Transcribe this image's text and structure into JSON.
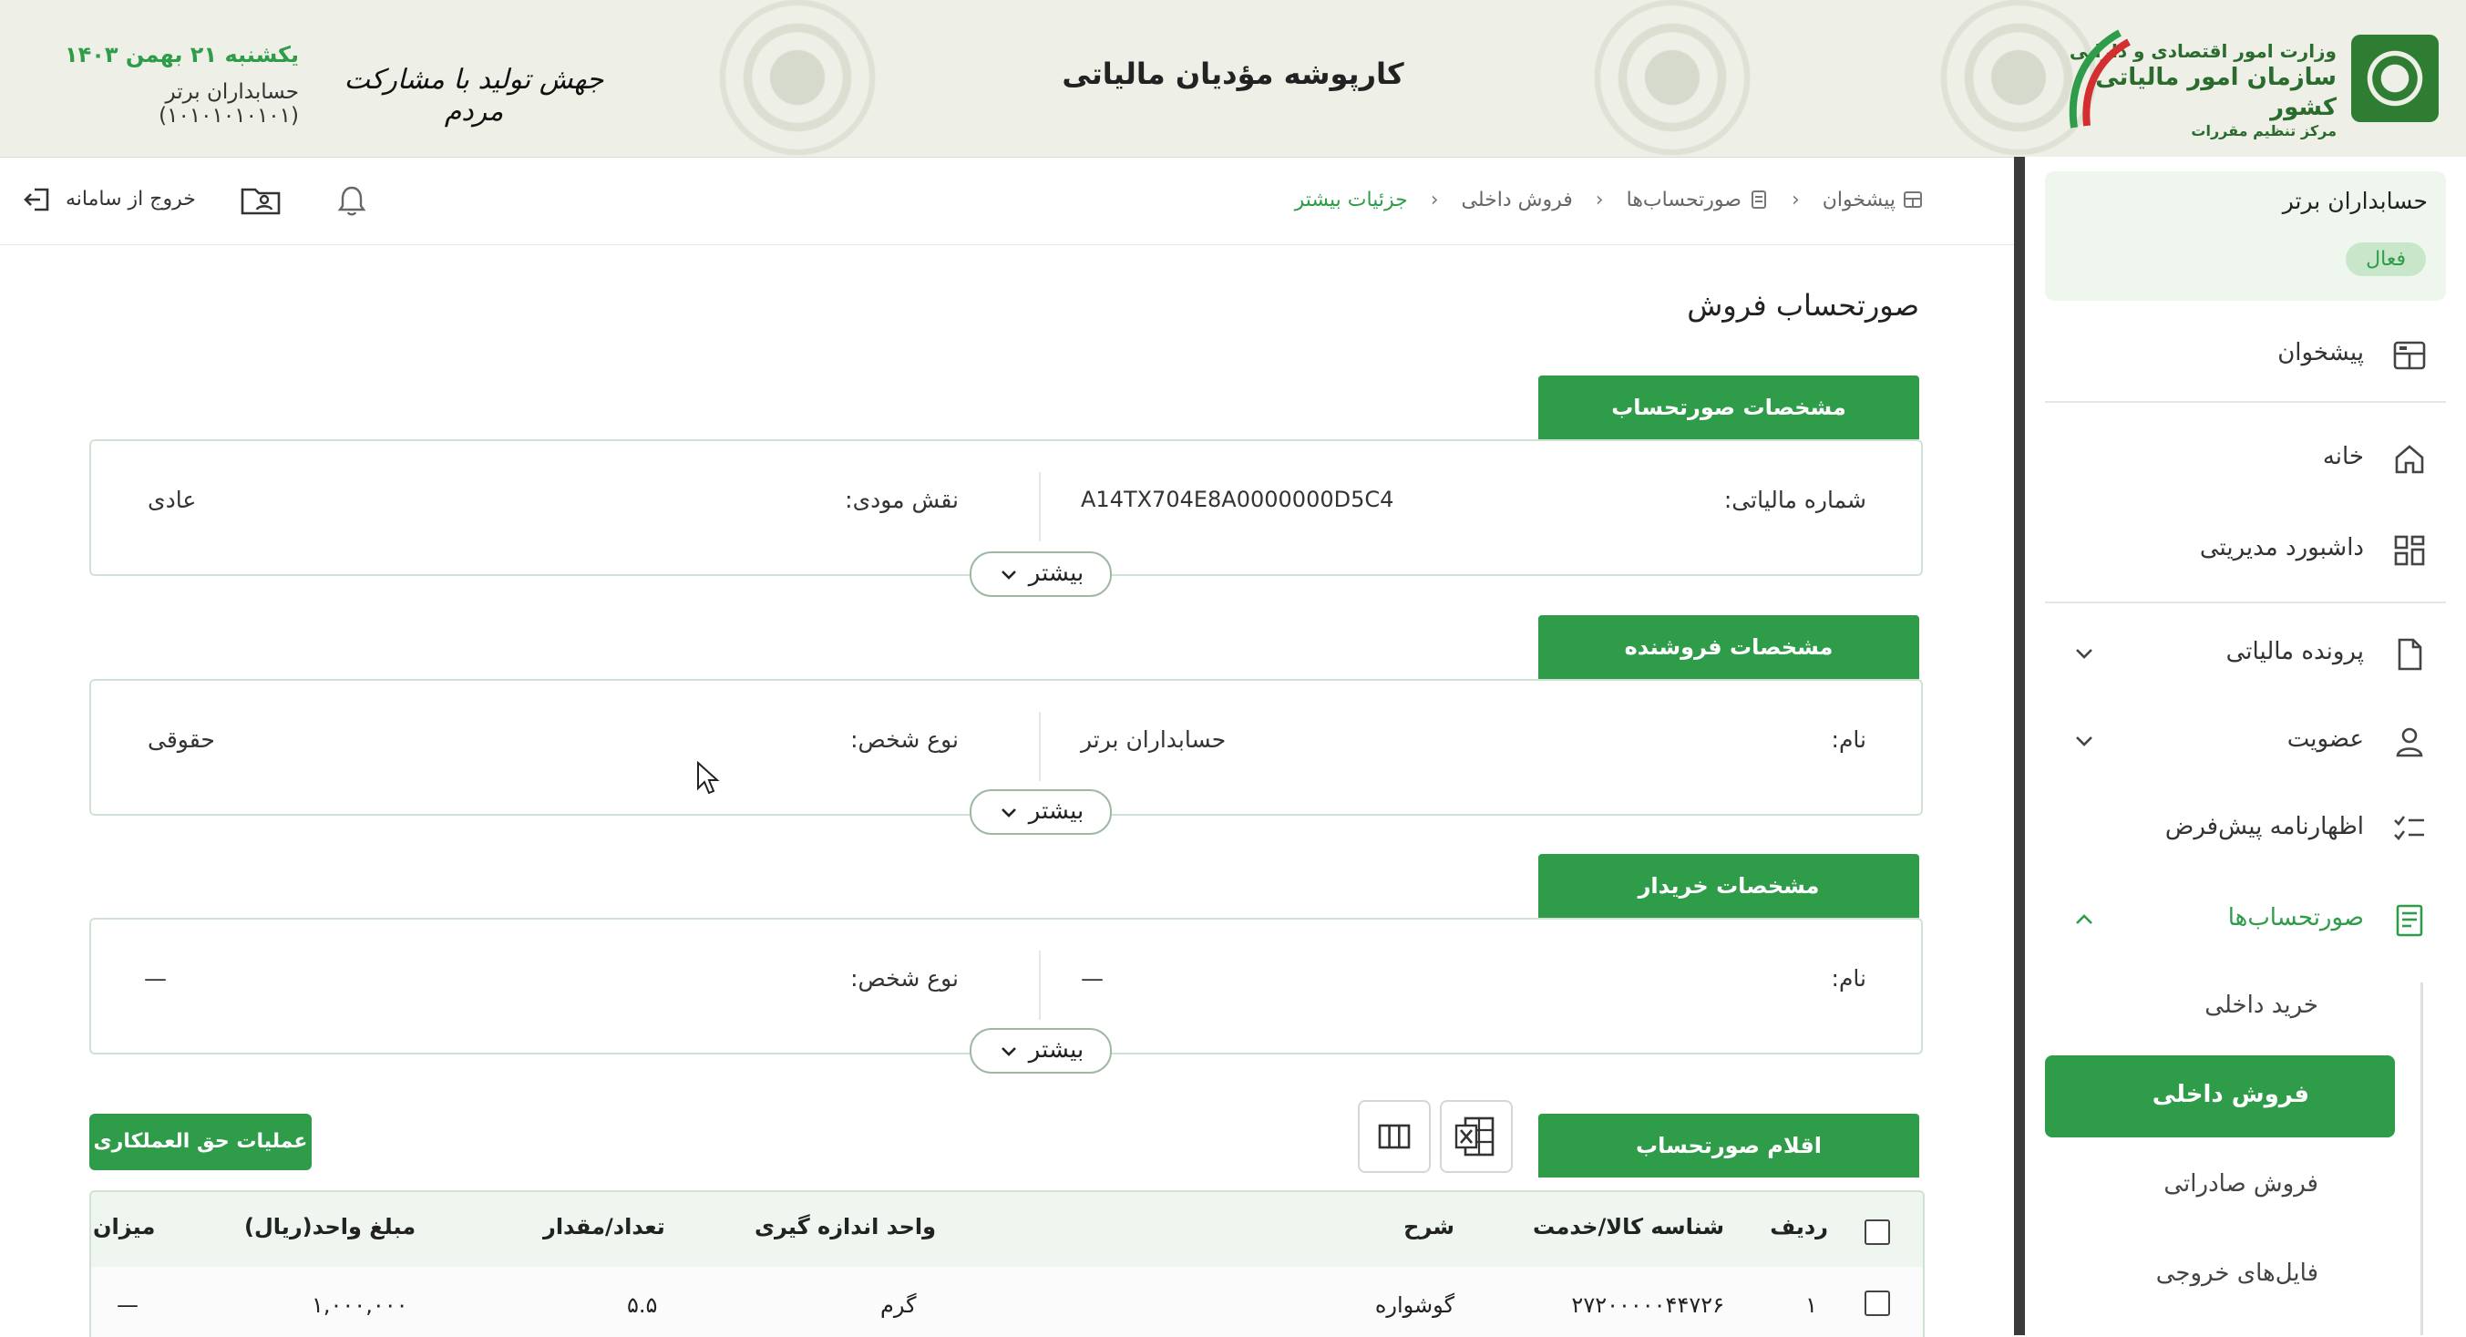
{
  "header": {
    "app_title": "کارپوشه مؤدیان مالیاتی",
    "slogan": "جهش تولید با مشارکت مردم",
    "date": "یکشنبه ۲۱ بهمن ۱۴۰۳",
    "user": "حسابداران برتر (۱۰۱۰۱۰۱۰۱۰۱)",
    "logo": {
      "line1": "وزارت امور اقتصادی و دارایی",
      "line2": "سازمان امور مالیاتی کشور",
      "line3": "مرکز تنظیم مقررات"
    }
  },
  "toolbar": {
    "breadcrumb": [
      "پیشخوان",
      "صورتحساب‌ها",
      "فروش داخلی",
      "جزئیات بیشتر"
    ],
    "logout": "خروج از سامانه"
  },
  "sidebar": {
    "account_name": "حسابداران برتر",
    "status": "فعال",
    "items": [
      {
        "label": "پیشخوان",
        "icon": "dashboard-icon"
      },
      {
        "label": "خانه",
        "icon": "home-icon"
      },
      {
        "label": "داشبورد مدیریتی",
        "icon": "grid-icon"
      },
      {
        "label": "پرونده مالیاتی",
        "icon": "file-icon"
      },
      {
        "label": "عضویت",
        "icon": "user-icon"
      },
      {
        "label": "اظهارنامه پیش‌فرض",
        "icon": "checklist-icon"
      },
      {
        "label": "صورتحساب‌ها",
        "icon": "receipt-icon"
      }
    ],
    "subitems": [
      "خرید داخلی",
      "فروش داخلی",
      "فروش صادراتی",
      "فایل‌های خروجی"
    ],
    "active_subitem": "فروش داخلی"
  },
  "main": {
    "page_title": "صورتحساب فروش",
    "more_label": "بیشتر",
    "invoice": {
      "tab": "مشخصات صورتحساب",
      "tax_no_label": "شماره مالیاتی:",
      "tax_no_value": "A14TX704E8A0000000D5C4",
      "role_label": "نقش مودی:",
      "role_value": "عادی"
    },
    "seller": {
      "tab": "مشخصات فروشنده",
      "name_label": "نام:",
      "name_value": "حسابداران برتر",
      "type_label": "نوع شخص:",
      "type_value": "حقوقی"
    },
    "buyer": {
      "tab": "مشخصات خریدار",
      "name_label": "نام:",
      "name_value": "—",
      "type_label": "نوع شخص:",
      "type_value": "—"
    },
    "items": {
      "tab": "اقلام صورتحساب",
      "ops_button": "عملیات حق العملکاری",
      "columns": [
        "ردیف",
        "شناسه کالا/خدمت",
        "شرح",
        "واحد اندازه گیری",
        "تعداد/مقدار",
        "مبلغ واحد(ریال)",
        "میزان"
      ],
      "rows": [
        {
          "idx": "۱",
          "code": "۲۷۲۰۰۰۰۰۴۴۷۲۶",
          "desc": "گوشواره",
          "unit": "گرم",
          "qty": "۵.۵",
          "price": "۱,۰۰۰,۰۰۰",
          "rate": "—"
        }
      ]
    }
  },
  "colors": {
    "brand_green": "#2e9c49",
    "header_bg": "#eef0e8",
    "sidebar_divider": "#3b3b3b"
  }
}
